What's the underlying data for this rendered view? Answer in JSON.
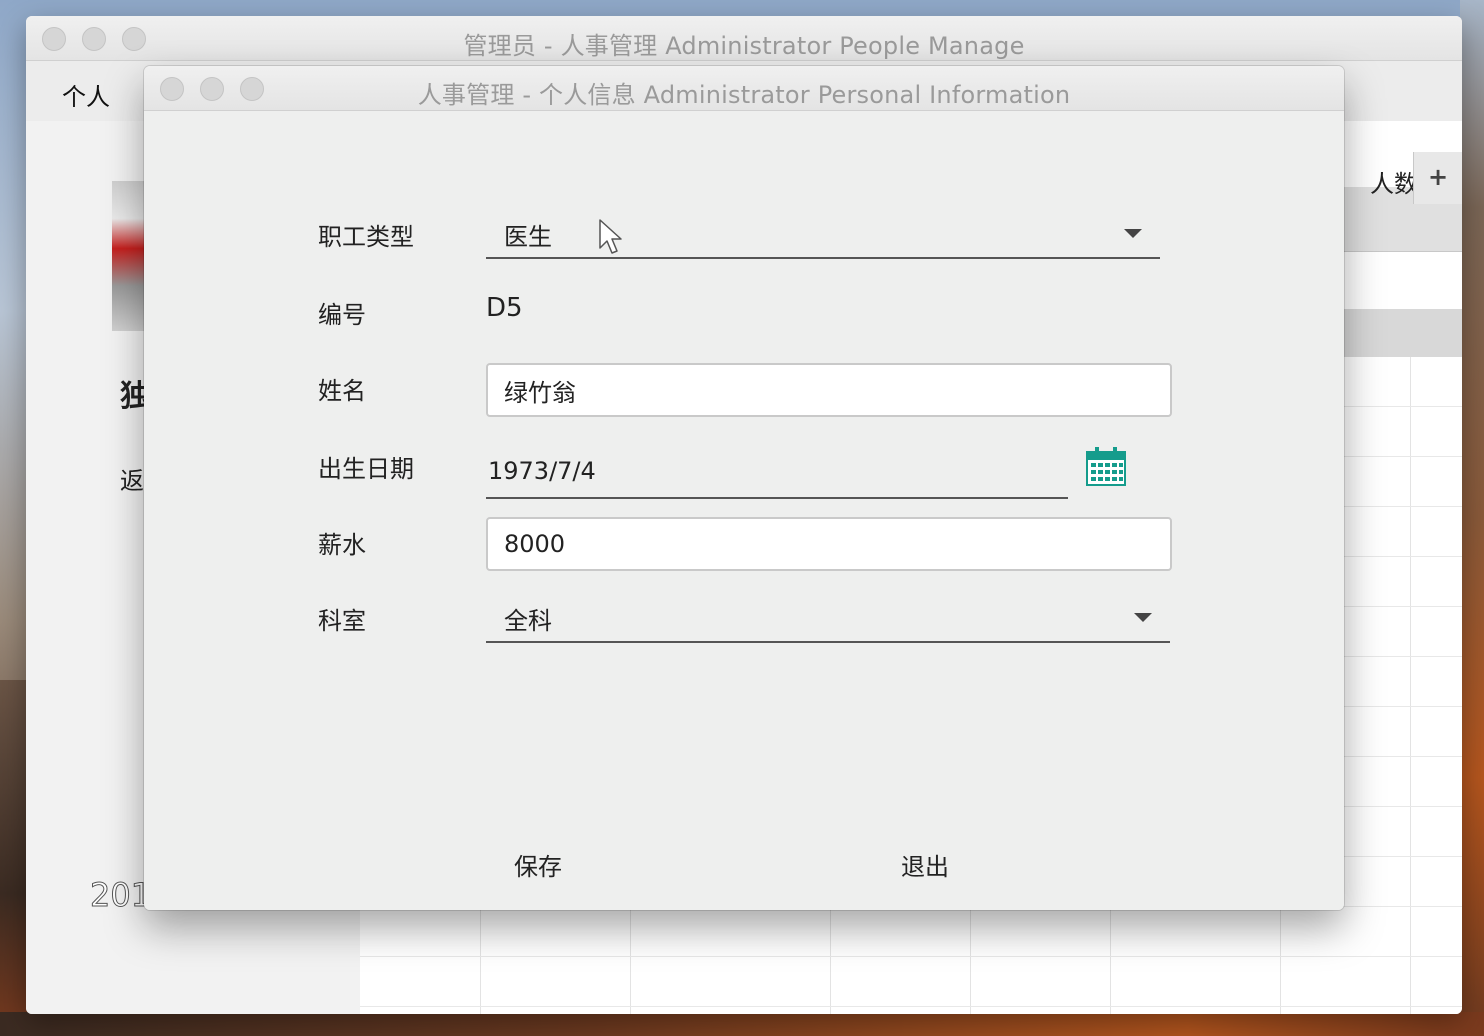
{
  "back_window": {
    "title": "管理员 - 人事管理 Administrator People Manage",
    "menu_label": "个人",
    "name_partial": "独",
    "return_partial": "返",
    "year_partial": "201",
    "table_header_partial": "人数",
    "add_column_label": "+"
  },
  "dialog": {
    "title": "人事管理 - 个人信息 Administrator Personal Information",
    "form": {
      "staff_type_label": "职工类型",
      "staff_type_value": "医生",
      "id_label": "编号",
      "id_value": "D5",
      "name_label": "姓名",
      "name_value": "绿竹翁",
      "birthdate_label": "出生日期",
      "birthdate_value": "1973/7/4",
      "salary_label": "薪水",
      "salary_value": "8000",
      "department_label": "科室",
      "department_value": "全科"
    },
    "buttons": {
      "save": "保存",
      "exit": "退出"
    }
  },
  "icons": {
    "calendar": "calendar-icon",
    "dropdown": "chevron-down-icon",
    "cursor": "mouse-pointer-icon"
  },
  "colors": {
    "calendar_accent": "#159c8c",
    "window_bg": "#eeeeee"
  }
}
